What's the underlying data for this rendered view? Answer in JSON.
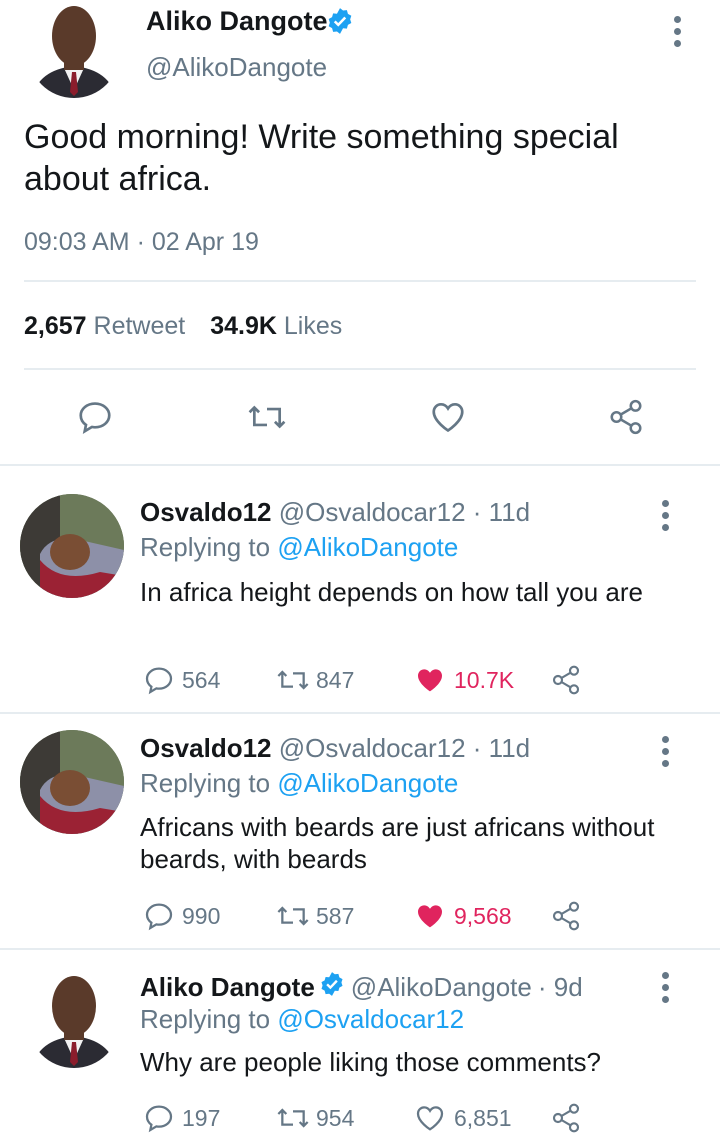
{
  "main_tweet": {
    "author_name": "Aliko Dangote",
    "handle": "@AlikoDangote",
    "text": "Good morning! Write something special about africa.",
    "timestamp": "09:03 AM · 02 Apr 19",
    "retweet_count": "2,657",
    "retweet_label": "Retweet",
    "like_count": "34.9K",
    "like_label": "Likes"
  },
  "replies": [
    {
      "name": "Osvaldo12",
      "handle": "@Osvaldocar12",
      "age": "· 11d",
      "replying_prefix": "Replying to",
      "replying_to": "@AlikoDangote",
      "text": "In africa height depends on how tall you are",
      "replies": "564",
      "retweets": "847",
      "likes": "10.7K"
    },
    {
      "name": "Osvaldo12",
      "handle": "@Osvaldocar12",
      "age": "· 11d",
      "replying_prefix": "Replying to",
      "replying_to": "@AlikoDangote",
      "text": "Africans with beards are just africans without beards, with beards",
      "replies": "990",
      "retweets": "587",
      "likes": "9,568"
    },
    {
      "name": "Aliko Dangote",
      "handle": "@AlikoDangote",
      "age": "· 9d",
      "replying_prefix": "Replying to",
      "replying_to": "@Osvaldocar12",
      "text": "Why are people liking those comments?",
      "replies": "197",
      "retweets": "954",
      "likes": "6,851"
    }
  ],
  "colors": {
    "accent": "#1da1f2",
    "muted": "#657786",
    "like_red": "#e0245e",
    "divider": "#e6ecf0"
  },
  "icons": [
    "verified-badge-icon",
    "more-options-icon",
    "reply-icon",
    "retweet-icon",
    "like-icon",
    "share-icon"
  ]
}
